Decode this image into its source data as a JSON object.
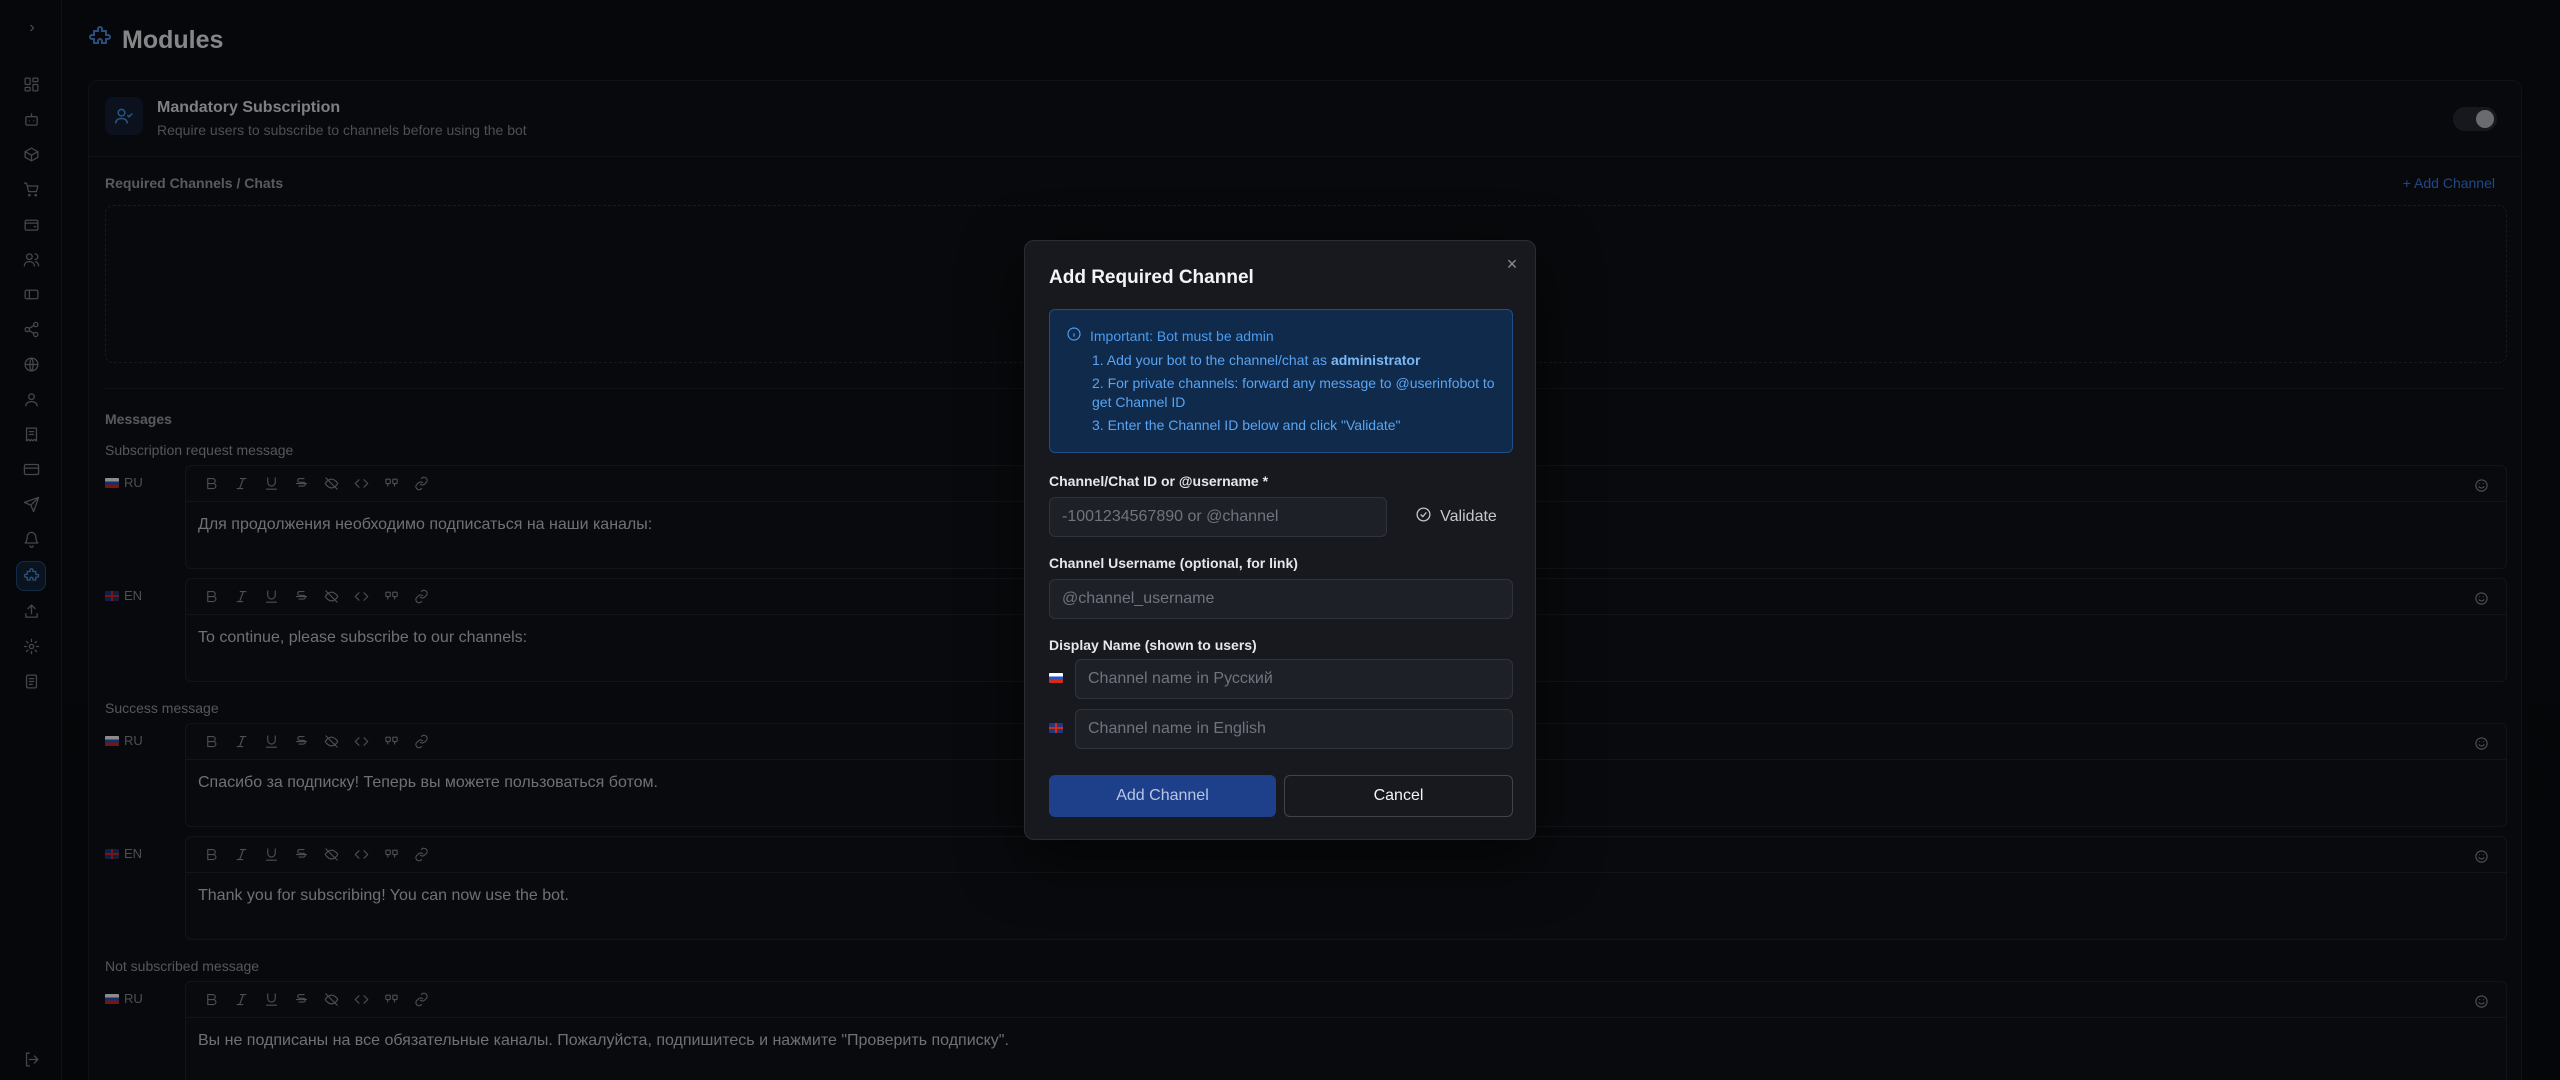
{
  "page": {
    "title": "Modules"
  },
  "sidebar": {
    "toggle_icon": "chevron-right-icon",
    "items": [
      {
        "name": "dashboard-icon"
      },
      {
        "name": "bot-icon"
      },
      {
        "name": "package-icon"
      },
      {
        "name": "cart-icon"
      },
      {
        "name": "wallet-icon"
      },
      {
        "name": "users-icon"
      },
      {
        "name": "ticket-icon"
      },
      {
        "name": "share-icon"
      },
      {
        "name": "globe-icon"
      },
      {
        "name": "team-icon"
      },
      {
        "name": "receipt-icon"
      },
      {
        "name": "card-icon"
      },
      {
        "name": "send-icon"
      },
      {
        "name": "bell-icon"
      },
      {
        "name": "puzzle-icon",
        "active": true
      },
      {
        "name": "upload-icon"
      },
      {
        "name": "settings-icon"
      },
      {
        "name": "document-icon"
      },
      {
        "name": "logout-icon"
      }
    ]
  },
  "module": {
    "title": "Mandatory Subscription",
    "description": "Require users to subscribe to channels before using the bot",
    "enabled": true
  },
  "channels": {
    "label": "Required Channels / Chats",
    "add_link": "+ Add Channel"
  },
  "messages": {
    "label": "Messages",
    "groups": [
      {
        "label": "Subscription request message",
        "ru": {
          "lang": "RU",
          "text": "Для продолжения необходимо подписаться на наши каналы:"
        },
        "en": {
          "lang": "EN",
          "text": "To continue, please subscribe to our channels:"
        }
      },
      {
        "label": "Success message",
        "ru": {
          "lang": "RU",
          "text": "Спасибо за подписку! Теперь вы можете пользоваться ботом."
        },
        "en": {
          "lang": "EN",
          "text": "Thank you for subscribing! You can now use the bot."
        }
      },
      {
        "label": "Not subscribed message",
        "ru": {
          "lang": "RU",
          "text": "Вы не подписаны на все обязательные каналы. Пожалуйста, подпишитесь и нажмите \"Проверить подписку\"."
        }
      }
    ]
  },
  "modal": {
    "title": "Add Required Channel",
    "info": {
      "heading": "Important: Bot must be admin",
      "step1_prefix": "1. Add your bot to the channel/chat as ",
      "step1_bold": "administrator",
      "step2": "2. For private channels: forward any message to @userinfobot to get Channel ID",
      "step3": "3. Enter the Channel ID below and click \"Validate\""
    },
    "channel_id": {
      "label": "Channel/Chat ID or @username *",
      "placeholder": "-1001234567890 or @channel"
    },
    "validate_label": "Validate",
    "username": {
      "label": "Channel Username (optional, for link)",
      "placeholder": "@channel_username"
    },
    "display_name": {
      "label": "Display Name (shown to users)",
      "ru_placeholder": "Channel name in Русский",
      "en_placeholder": "Channel name in English"
    },
    "add_button": "Add Channel",
    "cancel_button": "Cancel"
  }
}
